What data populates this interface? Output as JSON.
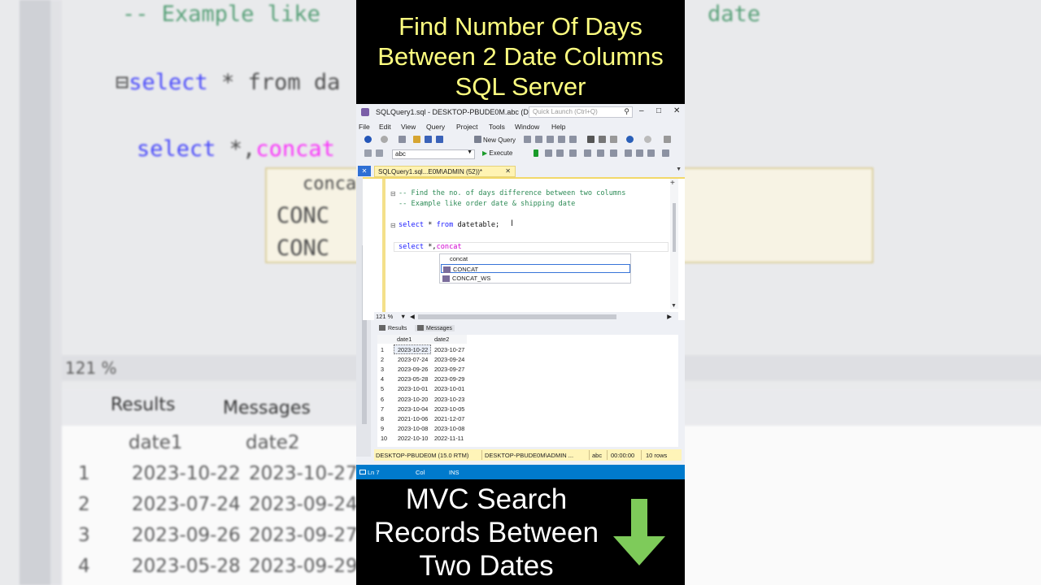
{
  "overlay": {
    "title_lines": [
      "Find Number Of Days",
      "Between 2 Date Columns",
      "SQL Server"
    ],
    "cta_lines": [
      "MVC Search",
      "Records Between",
      "Two Dates"
    ],
    "cta_arrow_color": "#7ecb5a",
    "title_color": "#ffff80"
  },
  "window": {
    "title": "SQLQuery1.sql - DESKTOP-PBUDE0M.abc (DE...",
    "quick_launch_placeholder": "Quick Launch (Ctrl+Q)",
    "controls": {
      "minimize": "–",
      "maximize": "□",
      "close": "✕"
    }
  },
  "menu": [
    "File",
    "Edit",
    "View",
    "Query",
    "Project",
    "Tools",
    "Window",
    "Help"
  ],
  "toolbar": {
    "new_query_label": "New Query",
    "database": "abc",
    "execute_label": "Execute"
  },
  "tab": {
    "label": "SQLQuery1.sql...E0M\\ADMIN (52))*",
    "close": "✕"
  },
  "editor": {
    "comment1": "-- Find the no. of days difference between two columns",
    "comment2": "-- Example like order date & shipping date",
    "line3_kw1": "select",
    "line3_rest": " * ",
    "line3_kw2": "from",
    "line3_tbl": " datetable;",
    "line4_kw": "select",
    "line4_rest": " *,",
    "line4_fn": "concat",
    "autocomplete": {
      "header": "concat",
      "items": [
        "CONCAT",
        "CONCAT_WS"
      ]
    },
    "zoom": "121 %"
  },
  "results": {
    "tabs": [
      "Results",
      "Messages"
    ],
    "columns": [
      "date1",
      "date2"
    ],
    "rows": [
      [
        "1",
        "2023-10-22",
        "2023-10-27"
      ],
      [
        "2",
        "2023-07-24",
        "2023-09-24"
      ],
      [
        "3",
        "2023-09-26",
        "2023-09-27"
      ],
      [
        "4",
        "2023-05-28",
        "2023-09-29"
      ],
      [
        "5",
        "2023-10-01",
        "2023-10-01"
      ],
      [
        "6",
        "2023-10-20",
        "2023-10-23"
      ],
      [
        "7",
        "2023-10-04",
        "2023-10-05"
      ],
      [
        "8",
        "2021-10-06",
        "2021-12-07"
      ],
      [
        "9",
        "2023-10-08",
        "2023-10-08"
      ],
      [
        "10",
        "2022-10-10",
        "2022-11-11"
      ]
    ]
  },
  "status": {
    "server": "DESKTOP-PBUDE0M (15.0 RTM)",
    "user": "DESKTOP-PBUDE0M\\ADMIN ...",
    "db": "abc",
    "time": "00:00:00",
    "rows": "10 rows"
  },
  "statusline": {
    "ln": "Ln 7",
    "col": "Col",
    "mode": "INS"
  },
  "background": {
    "comment": "-- Example like",
    "comment_tail": "date",
    "select1": "select",
    "star_from": "* from",
    "tbl_frag": "da",
    "select2": "select",
    "star2": " *,",
    "fn2": "concat",
    "ac_header": "concat",
    "ac_item": "CONC",
    "zoom": "121 %",
    "tab_results": "Results",
    "tab_messages": "Messages",
    "col1": "date1",
    "col2": "date2"
  }
}
